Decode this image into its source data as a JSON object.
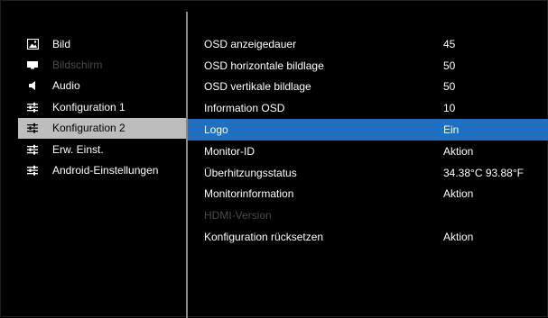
{
  "sidebar": {
    "items": [
      {
        "label": "Bild",
        "icon": "picture-icon",
        "state": "normal"
      },
      {
        "label": "Bildschirm",
        "icon": "screen-icon",
        "state": "disabled"
      },
      {
        "label": "Audio",
        "icon": "speaker-icon",
        "state": "normal"
      },
      {
        "label": "Konfiguration 1",
        "icon": "sliders-icon",
        "state": "normal"
      },
      {
        "label": "Konfiguration 2",
        "icon": "sliders-icon",
        "state": "selected"
      },
      {
        "label": "Erw. Einst.",
        "icon": "sliders-icon",
        "state": "normal"
      },
      {
        "label": "Android-Einstellungen",
        "icon": "sliders-icon",
        "state": "normal"
      }
    ]
  },
  "settings": {
    "rows": [
      {
        "label": "OSD anzeigedauer",
        "value": "45",
        "state": "normal"
      },
      {
        "label": "OSD horizontale bildlage",
        "value": "50",
        "state": "normal"
      },
      {
        "label": "OSD vertikale bildlage",
        "value": "50",
        "state": "normal"
      },
      {
        "label": "Information OSD",
        "value": "10",
        "state": "normal"
      },
      {
        "label": "Logo",
        "value": "Ein",
        "state": "selected"
      },
      {
        "label": "Monitor-ID",
        "value": "Aktion",
        "state": "normal"
      },
      {
        "label": "Überhitzungsstatus",
        "value": "34.38°C 93.88°F",
        "state": "normal"
      },
      {
        "label": "Monitorinformation",
        "value": "Aktion",
        "state": "normal"
      },
      {
        "label": "HDMI-Version",
        "value": "",
        "state": "disabled"
      },
      {
        "label": "Konfiguration rücksetzen",
        "value": "Aktion",
        "state": "normal"
      }
    ]
  },
  "colors": {
    "background": "#000000",
    "highlight_left": "#bdbdbd",
    "highlight_right": "#1f70c1",
    "disabled_text": "#4a4a4a",
    "divider": "#8a8a8a"
  }
}
